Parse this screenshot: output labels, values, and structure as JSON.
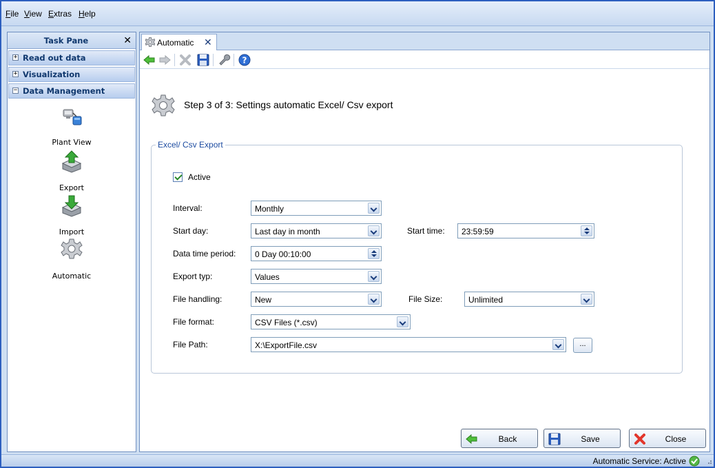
{
  "menu": [
    "File",
    "View",
    "Extras",
    "Help"
  ],
  "taskpane": {
    "title": "Task Pane",
    "groups": [
      {
        "label": "Read out data",
        "state": "+"
      },
      {
        "label": "Visualization",
        "state": "+"
      },
      {
        "label": "Data Management",
        "state": "−"
      }
    ],
    "tools": [
      {
        "label": "Plant View",
        "icon": "plant-view-icon"
      },
      {
        "label": "Export",
        "icon": "export-icon"
      },
      {
        "label": "Import",
        "icon": "import-icon"
      },
      {
        "label": "Automatic",
        "icon": "gear-icon"
      }
    ]
  },
  "tab": {
    "label": "Automatic"
  },
  "toolbar_icons": [
    "back-arrow-icon",
    "forward-arrow-icon",
    "delete-icon",
    "save-icon",
    "wrench-icon",
    "help-icon"
  ],
  "step_title": "Step 3 of 3: Settings automatic Excel/ Csv export",
  "group_title": "Excel/ Csv Export",
  "active": {
    "label": "Active",
    "checked": true
  },
  "fields": {
    "interval": {
      "label": "Interval:",
      "value": "Monthly"
    },
    "start_day": {
      "label": "Start day:",
      "value": "Last day in month"
    },
    "start_time": {
      "label": "Start time:",
      "value": "23:59:59"
    },
    "data_time_period": {
      "label": "Data time period:",
      "value": "0 Day 00:10:00"
    },
    "export_typ": {
      "label": "Export typ:",
      "value": "Values"
    },
    "file_handling": {
      "label": "File handling:",
      "value": "New"
    },
    "file_size": {
      "label": "File Size:",
      "value": "Unlimited"
    },
    "file_format": {
      "label": "File format:",
      "value": "CSV Files (*.csv)"
    },
    "file_path": {
      "label": "File Path:",
      "value": "X:\\ExportFile.csv"
    },
    "browse": "..."
  },
  "buttons": {
    "back": "Back",
    "save": "Save",
    "close": "Close"
  },
  "status": "Automatic Service: Active",
  "colors": {
    "accent": "#2d5fbf",
    "label_blue": "#10386e",
    "group_label": "#1c4ba0"
  }
}
